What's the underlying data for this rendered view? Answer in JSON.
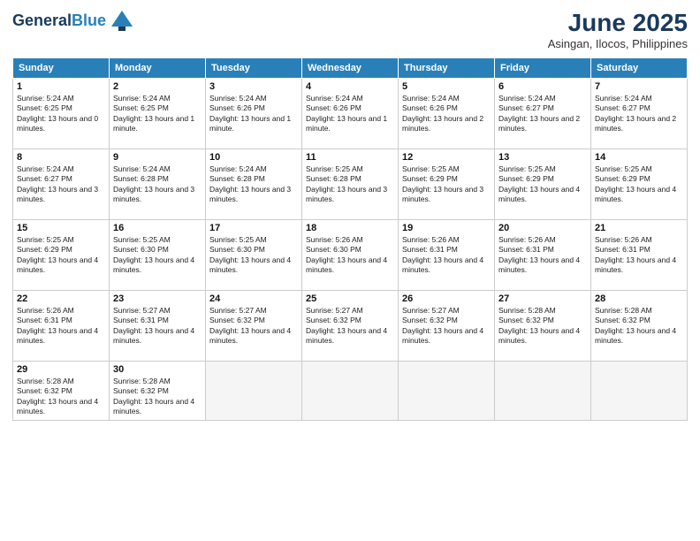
{
  "header": {
    "logo_line1": "General",
    "logo_line2": "Blue",
    "month": "June 2025",
    "location": "Asingan, Ilocos, Philippines"
  },
  "columns": [
    "Sunday",
    "Monday",
    "Tuesday",
    "Wednesday",
    "Thursday",
    "Friday",
    "Saturday"
  ],
  "weeks": [
    [
      {
        "day": "1",
        "sunrise": "5:24 AM",
        "sunset": "6:25 PM",
        "daylight": "13 hours and 0 minutes."
      },
      {
        "day": "2",
        "sunrise": "5:24 AM",
        "sunset": "6:25 PM",
        "daylight": "13 hours and 1 minute."
      },
      {
        "day": "3",
        "sunrise": "5:24 AM",
        "sunset": "6:26 PM",
        "daylight": "13 hours and 1 minute."
      },
      {
        "day": "4",
        "sunrise": "5:24 AM",
        "sunset": "6:26 PM",
        "daylight": "13 hours and 1 minute."
      },
      {
        "day": "5",
        "sunrise": "5:24 AM",
        "sunset": "6:26 PM",
        "daylight": "13 hours and 2 minutes."
      },
      {
        "day": "6",
        "sunrise": "5:24 AM",
        "sunset": "6:27 PM",
        "daylight": "13 hours and 2 minutes."
      },
      {
        "day": "7",
        "sunrise": "5:24 AM",
        "sunset": "6:27 PM",
        "daylight": "13 hours and 2 minutes."
      }
    ],
    [
      {
        "day": "8",
        "sunrise": "5:24 AM",
        "sunset": "6:27 PM",
        "daylight": "13 hours and 3 minutes."
      },
      {
        "day": "9",
        "sunrise": "5:24 AM",
        "sunset": "6:28 PM",
        "daylight": "13 hours and 3 minutes."
      },
      {
        "day": "10",
        "sunrise": "5:24 AM",
        "sunset": "6:28 PM",
        "daylight": "13 hours and 3 minutes."
      },
      {
        "day": "11",
        "sunrise": "5:25 AM",
        "sunset": "6:28 PM",
        "daylight": "13 hours and 3 minutes."
      },
      {
        "day": "12",
        "sunrise": "5:25 AM",
        "sunset": "6:29 PM",
        "daylight": "13 hours and 3 minutes."
      },
      {
        "day": "13",
        "sunrise": "5:25 AM",
        "sunset": "6:29 PM",
        "daylight": "13 hours and 4 minutes."
      },
      {
        "day": "14",
        "sunrise": "5:25 AM",
        "sunset": "6:29 PM",
        "daylight": "13 hours and 4 minutes."
      }
    ],
    [
      {
        "day": "15",
        "sunrise": "5:25 AM",
        "sunset": "6:29 PM",
        "daylight": "13 hours and 4 minutes."
      },
      {
        "day": "16",
        "sunrise": "5:25 AM",
        "sunset": "6:30 PM",
        "daylight": "13 hours and 4 minutes."
      },
      {
        "day": "17",
        "sunrise": "5:25 AM",
        "sunset": "6:30 PM",
        "daylight": "13 hours and 4 minutes."
      },
      {
        "day": "18",
        "sunrise": "5:26 AM",
        "sunset": "6:30 PM",
        "daylight": "13 hours and 4 minutes."
      },
      {
        "day": "19",
        "sunrise": "5:26 AM",
        "sunset": "6:31 PM",
        "daylight": "13 hours and 4 minutes."
      },
      {
        "day": "20",
        "sunrise": "5:26 AM",
        "sunset": "6:31 PM",
        "daylight": "13 hours and 4 minutes."
      },
      {
        "day": "21",
        "sunrise": "5:26 AM",
        "sunset": "6:31 PM",
        "daylight": "13 hours and 4 minutes."
      }
    ],
    [
      {
        "day": "22",
        "sunrise": "5:26 AM",
        "sunset": "6:31 PM",
        "daylight": "13 hours and 4 minutes."
      },
      {
        "day": "23",
        "sunrise": "5:27 AM",
        "sunset": "6:31 PM",
        "daylight": "13 hours and 4 minutes."
      },
      {
        "day": "24",
        "sunrise": "5:27 AM",
        "sunset": "6:32 PM",
        "daylight": "13 hours and 4 minutes."
      },
      {
        "day": "25",
        "sunrise": "5:27 AM",
        "sunset": "6:32 PM",
        "daylight": "13 hours and 4 minutes."
      },
      {
        "day": "26",
        "sunrise": "5:27 AM",
        "sunset": "6:32 PM",
        "daylight": "13 hours and 4 minutes."
      },
      {
        "day": "27",
        "sunrise": "5:28 AM",
        "sunset": "6:32 PM",
        "daylight": "13 hours and 4 minutes."
      },
      {
        "day": "28",
        "sunrise": "5:28 AM",
        "sunset": "6:32 PM",
        "daylight": "13 hours and 4 minutes."
      }
    ],
    [
      {
        "day": "29",
        "sunrise": "5:28 AM",
        "sunset": "6:32 PM",
        "daylight": "13 hours and 4 minutes."
      },
      {
        "day": "30",
        "sunrise": "5:28 AM",
        "sunset": "6:32 PM",
        "daylight": "13 hours and 4 minutes."
      },
      null,
      null,
      null,
      null,
      null
    ]
  ]
}
